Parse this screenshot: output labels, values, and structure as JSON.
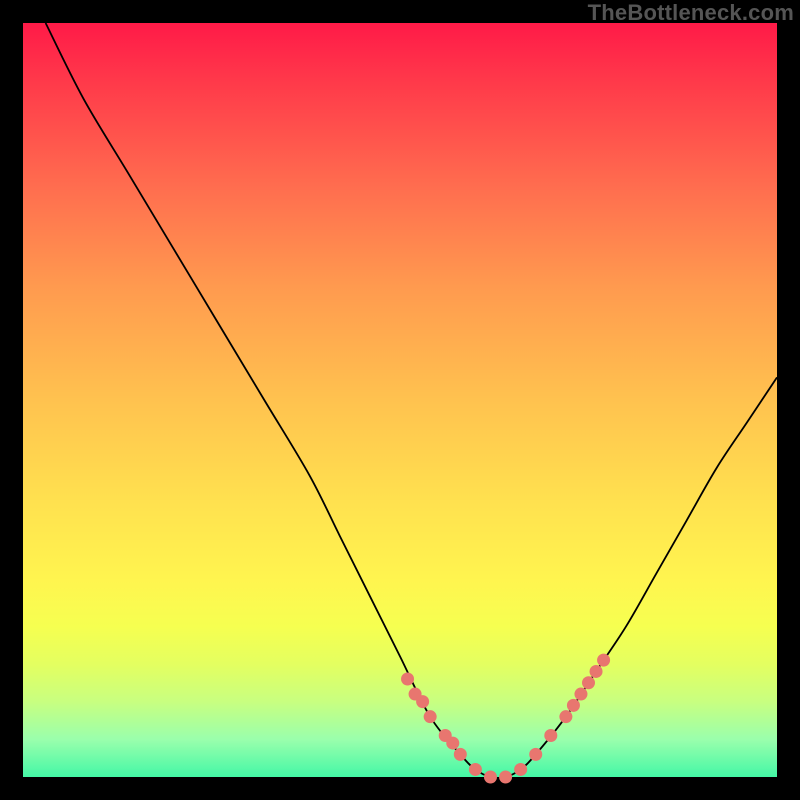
{
  "watermark": "TheBottleneck.com",
  "chart_data": {
    "type": "line",
    "title": "",
    "xlabel": "",
    "ylabel": "",
    "xlim": [
      0,
      100
    ],
    "ylim": [
      0,
      100
    ],
    "series": [
      {
        "name": "bottleneck-curve",
        "x": [
          3,
          8,
          14,
          20,
          26,
          32,
          38,
          42,
          46,
          50,
          54,
          58,
          60,
          62,
          64,
          66,
          68,
          72,
          76,
          80,
          84,
          88,
          92,
          96,
          100
        ],
        "y": [
          100,
          90,
          80,
          70,
          60,
          50,
          40,
          32,
          24,
          16,
          8,
          3,
          1,
          0,
          0,
          1,
          3,
          8,
          14,
          20,
          27,
          34,
          41,
          47,
          53
        ]
      }
    ],
    "markers": {
      "name": "highlight-dots",
      "color": "#e8766f",
      "x": [
        51,
        52,
        53,
        54,
        56,
        57,
        58,
        60,
        62,
        64,
        66,
        68,
        70,
        72,
        73,
        74,
        75,
        76,
        77
      ],
      "y": [
        13,
        11,
        10,
        8,
        5.5,
        4.5,
        3,
        1,
        0,
        0,
        1,
        3,
        5.5,
        8,
        9.5,
        11,
        12.5,
        14,
        15.5
      ]
    }
  }
}
